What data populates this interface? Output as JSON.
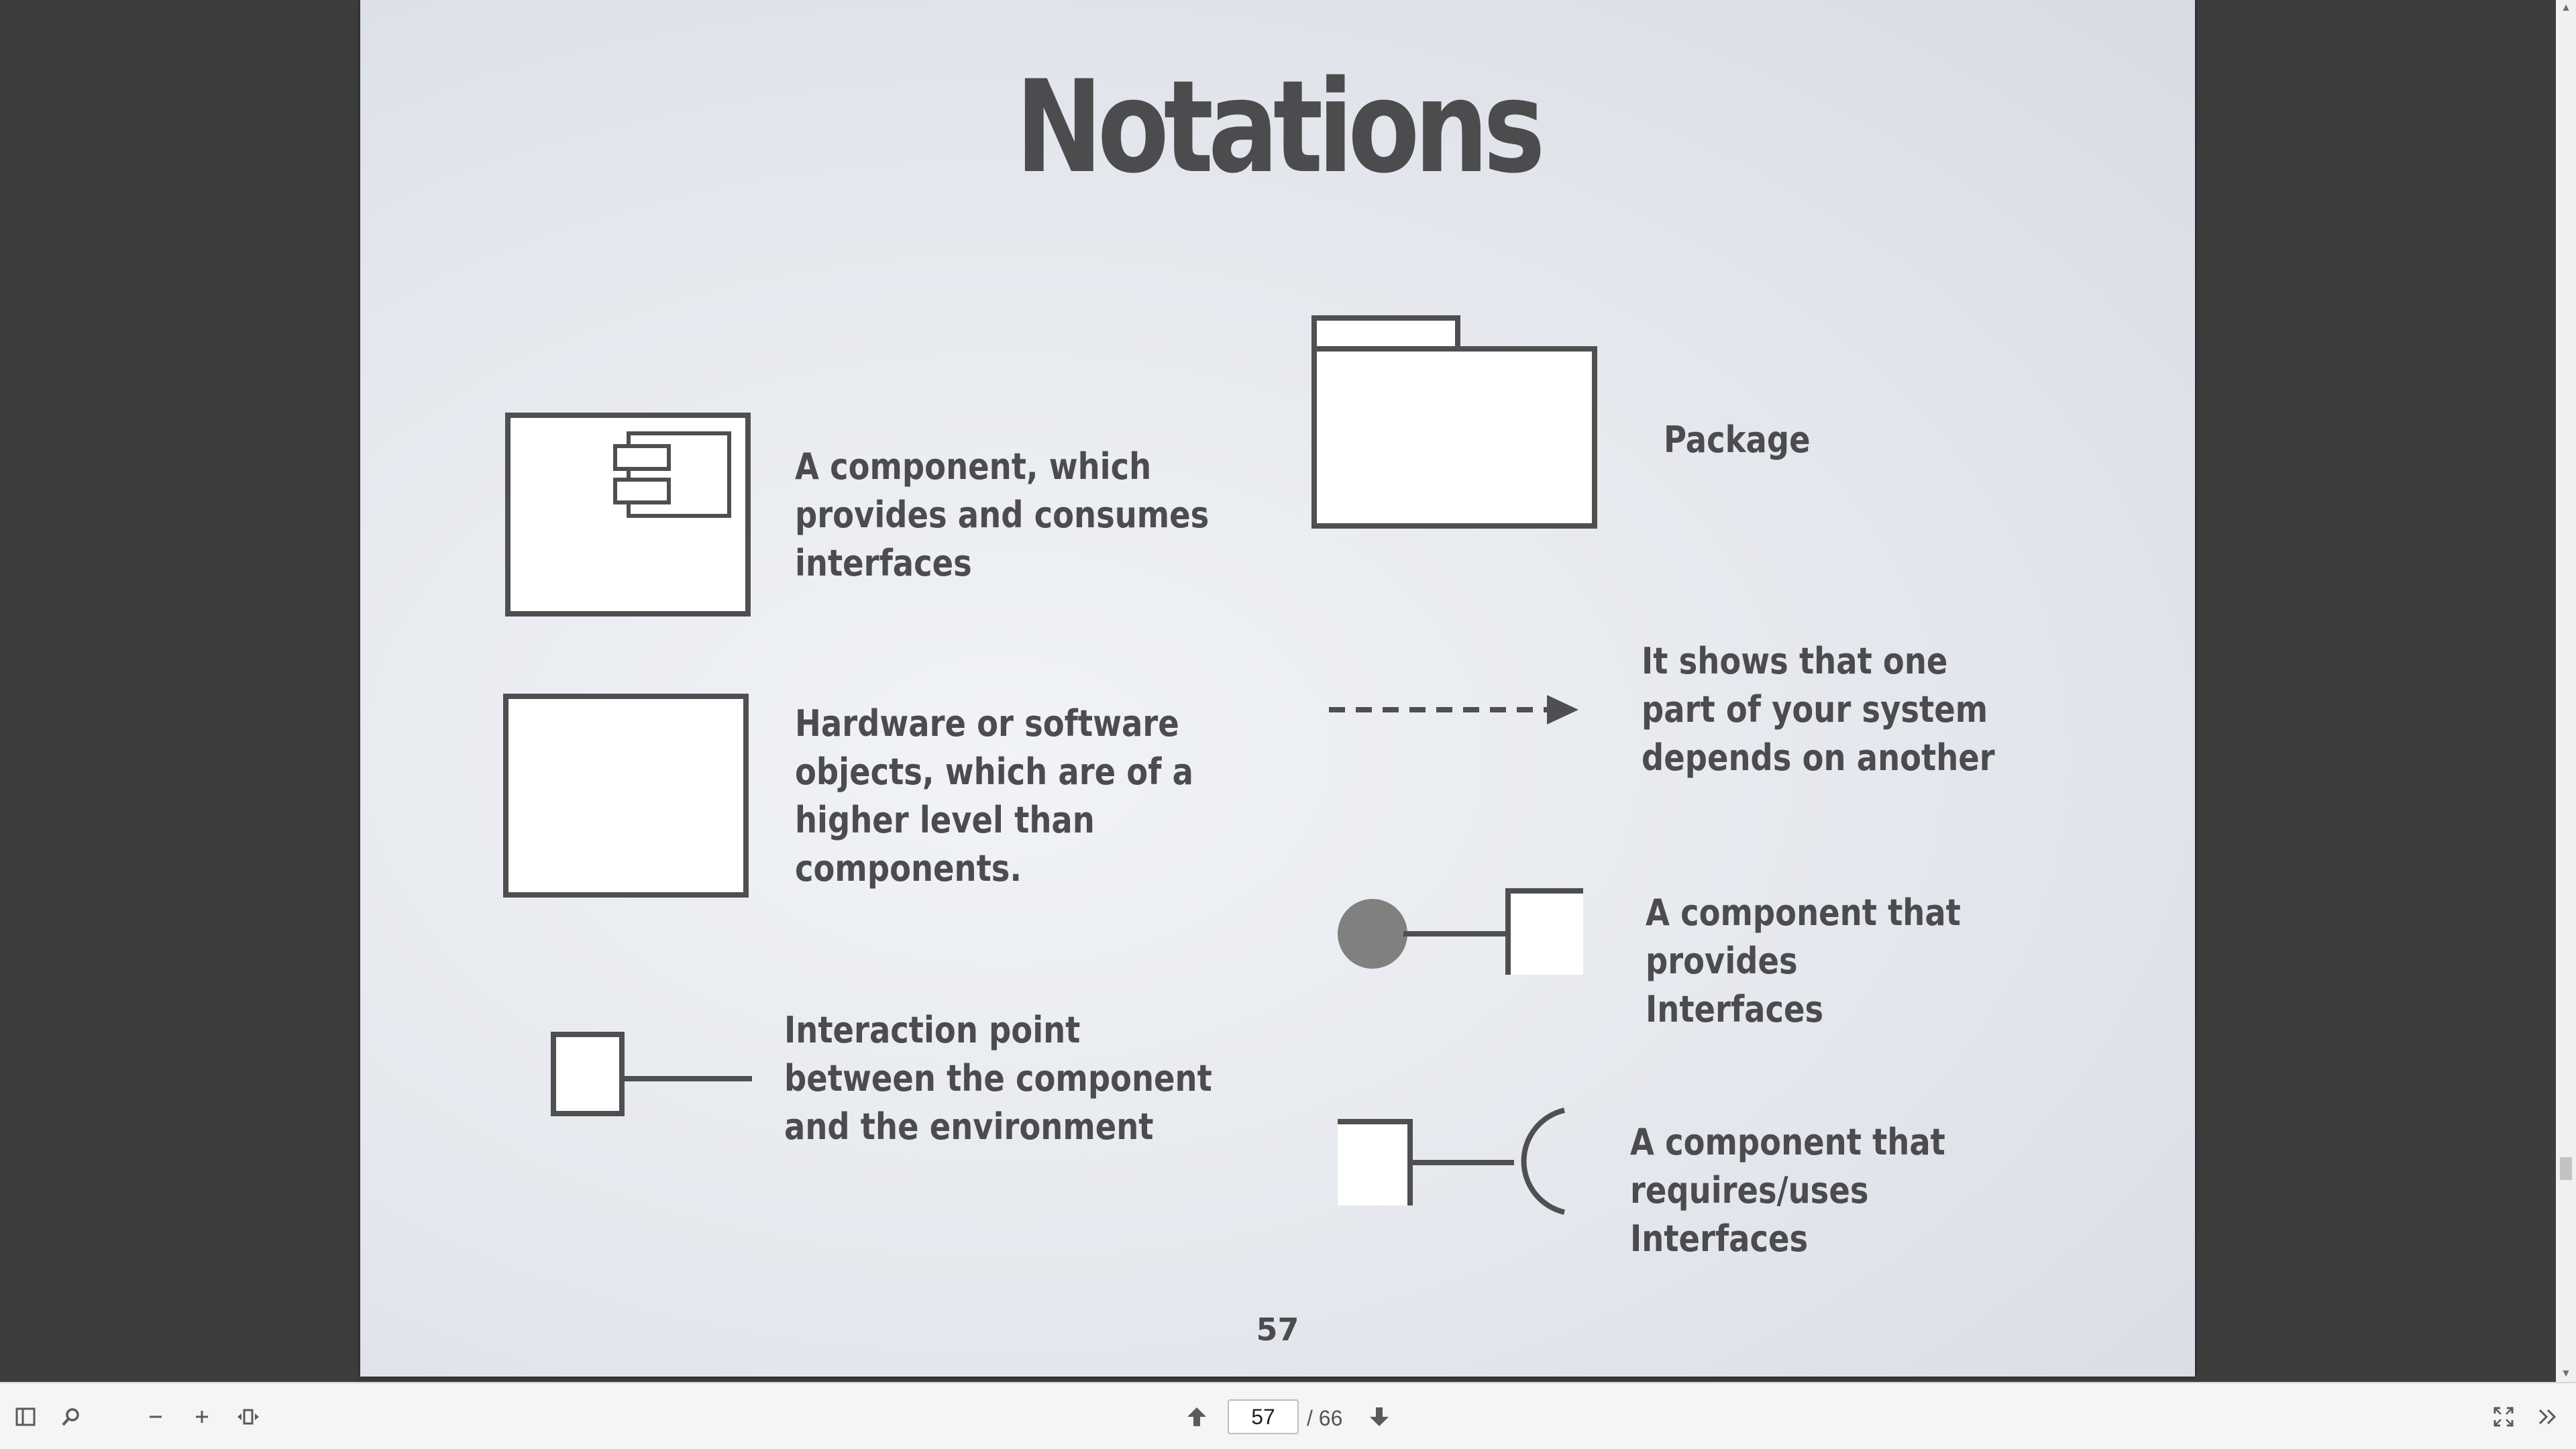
{
  "slide": {
    "title": "Notations",
    "page_number": "57",
    "items": {
      "component": "A component, which\nprovides and consumes\ninterfaces",
      "node": "Hardware or software\nobjects, which are of a\nhigher level than\ncomponents.",
      "port": "Interaction point\nbetween the component\nand the environment",
      "package": "Package",
      "dependency": "It shows that one\npart of your system\ndepends on another",
      "provided_interface": "A component that provides\nInterfaces",
      "required_interface": "A component that requires/uses\nInterfaces"
    }
  },
  "toolbar": {
    "current_page": "57",
    "total_pages": "/ 66",
    "icons": {
      "sidebar": "sidebar-toggle-icon",
      "search": "search-icon",
      "zoom_out": "minus-icon",
      "zoom_in": "plus-icon",
      "fit": "fit-width-icon",
      "prev": "arrow-up-icon",
      "next": "arrow-down-icon",
      "fullscreen": "fullscreen-icon",
      "more": "double-chevron-right-icon"
    }
  },
  "colors": {
    "shape_stroke": "#4f4f51",
    "shape_fill": "#ffffff",
    "circle_fill": "#808080",
    "text": "#4c4c4e",
    "background": "#3d3d3d"
  }
}
